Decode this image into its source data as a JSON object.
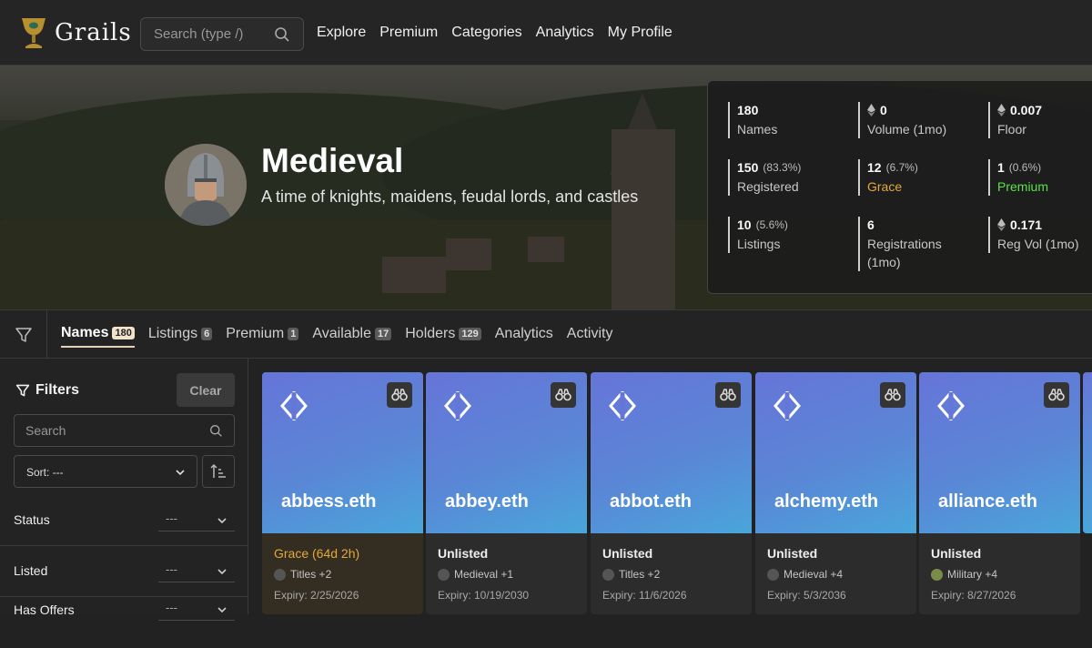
{
  "app": {
    "name": "Grails"
  },
  "topbar": {
    "search_placeholder": "Search (type /)",
    "nav": [
      "Explore",
      "Premium",
      "Categories",
      "Analytics",
      "My Profile"
    ]
  },
  "collection": {
    "title": "Medieval",
    "description": "A time of knights, maidens, feudal lords, and castles"
  },
  "stats": [
    {
      "value": "180",
      "sub": "",
      "label": "Names",
      "eth": false
    },
    {
      "value": "0",
      "sub": "",
      "label": "Volume (1mo)",
      "eth": true
    },
    {
      "value": "0.007",
      "sub": "",
      "label": "Floor",
      "eth": true
    },
    {
      "value": "150",
      "sub": "(83.3%)",
      "label": "Registered",
      "eth": false
    },
    {
      "value": "12",
      "sub": "(6.7%)",
      "label": "Grace",
      "eth": false
    },
    {
      "value": "1",
      "sub": "(0.6%)",
      "label": "Premium",
      "eth": false
    },
    {
      "value": "10",
      "sub": "(5.6%)",
      "label": "Listings",
      "eth": false
    },
    {
      "value": "6",
      "sub": "",
      "label": "Registrations (1mo)",
      "eth": false
    },
    {
      "value": "0.171",
      "sub": "",
      "label": "Reg Vol (1mo)",
      "eth": true
    }
  ],
  "tabs": [
    {
      "label": "Names",
      "count": "180"
    },
    {
      "label": "Listings",
      "count": "6"
    },
    {
      "label": "Premium",
      "count": "1"
    },
    {
      "label": "Available",
      "count": "17"
    },
    {
      "label": "Holders",
      "count": "129"
    },
    {
      "label": "Analytics",
      "count": ""
    },
    {
      "label": "Activity",
      "count": ""
    }
  ],
  "filters": {
    "title": "Filters",
    "clear_label": "Clear",
    "search_placeholder": "Search",
    "sort_label": "Sort:",
    "sort_value": "---",
    "rows": [
      {
        "label": "Status",
        "value": "---"
      },
      {
        "label": "Listed",
        "value": "---"
      },
      {
        "label": "Has Offers",
        "value": "---"
      }
    ]
  },
  "cards": [
    {
      "name": "abbess.eth",
      "status": "Grace (64d 2h)",
      "category": "Titles +2",
      "expiry": "Expiry: 2/25/2026",
      "grace": true
    },
    {
      "name": "abbey.eth",
      "status": "Unlisted",
      "category": "Medieval +1",
      "expiry": "Expiry: 10/19/2030",
      "grace": false
    },
    {
      "name": "abbot.eth",
      "status": "Unlisted",
      "category": "Titles +2",
      "expiry": "Expiry: 11/6/2026",
      "grace": false
    },
    {
      "name": "alchemy.eth",
      "status": "Unlisted",
      "category": "Medieval +4",
      "expiry": "Expiry: 5/3/2036",
      "grace": false
    },
    {
      "name": "alliance.eth",
      "status": "Unlisted",
      "category": "Military +4",
      "expiry": "Expiry: 8/27/2026",
      "grace": false
    }
  ],
  "colors": {
    "grace": "#e3a83c",
    "premium": "#5fe04c",
    "card_gradient_start": "#6675d8",
    "card_gradient_end": "#49a6da"
  }
}
